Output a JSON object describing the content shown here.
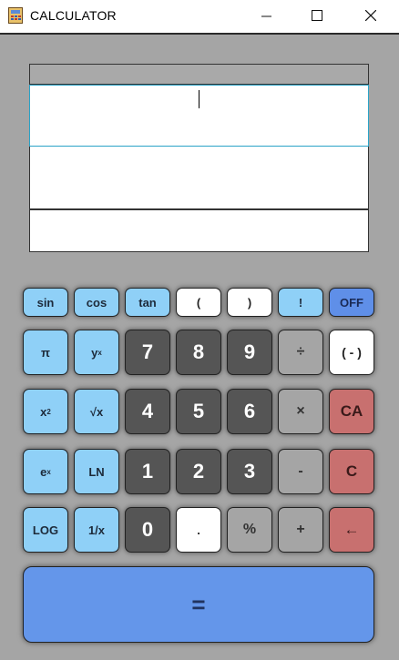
{
  "window": {
    "title": "CALCULATOR",
    "controls": [
      "minimize-icon",
      "maximize-icon",
      "close-icon"
    ]
  },
  "display": {
    "header": "",
    "expression": "",
    "secondary": "",
    "result": ""
  },
  "keys": {
    "row1": [
      "sin",
      "cos",
      "tan",
      "(",
      ")",
      "!",
      "OFF"
    ],
    "row2": [
      "π",
      "y",
      "7",
      "8",
      "9",
      "÷",
      "( - )"
    ],
    "row2_sup": "x",
    "row3": [
      "x",
      "√x",
      "4",
      "5",
      "6",
      "×",
      "CA"
    ],
    "row3_sup": "2",
    "row4": [
      "e",
      "LN",
      "1",
      "2",
      "3",
      "-",
      "C"
    ],
    "row4_sup": "x",
    "row5": [
      "LOG",
      "1/x",
      "0",
      ".",
      "%",
      "+",
      "←"
    ],
    "equals": "="
  },
  "colors": {
    "function_key": "#8fd0f7",
    "digit_key": "#555555",
    "operator_key": "#a5a5a5",
    "clear_key": "#c8706f",
    "off_key": "#5f8fe8",
    "equals_key": "#6496ea",
    "body": "#a5a5a5"
  }
}
